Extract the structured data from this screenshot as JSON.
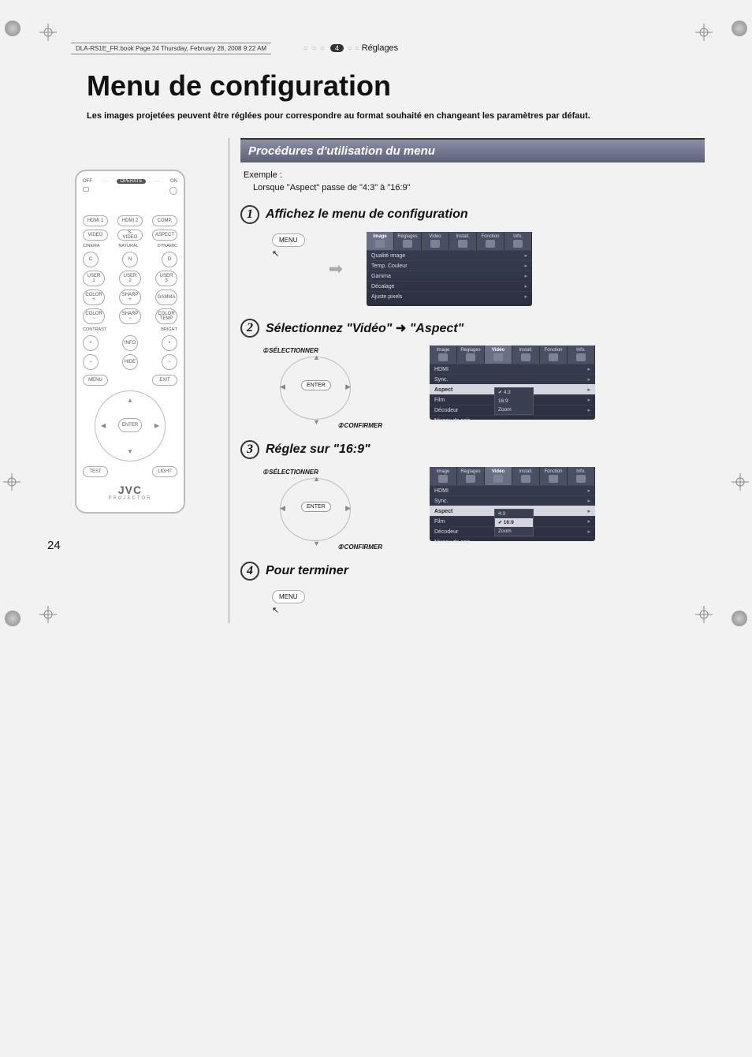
{
  "header_line": "DLA-RS1E_FR.book  Page 24  Thursday, February 28, 2008  9:22 AM",
  "section_badge": "4",
  "section_label": "Réglages",
  "title": "Menu de configuration",
  "intro": "Les images projetées peuvent être réglées pour correspondre au format souhaité en changeant les paramètres par défaut.",
  "procedures_title": "Procédures d'utilisation du menu",
  "example_label": "Exemple :",
  "example_text": "Lorsque \"Aspect\" passe de \"4:3\" à \"16:9\"",
  "steps": [
    {
      "num": "1",
      "title": "Affichez le menu de configuration"
    },
    {
      "num": "2",
      "title_a": "Sélectionnez \"Vidéo\"",
      "title_b": "\"Aspect\""
    },
    {
      "num": "3",
      "title": "Réglez sur \"16:9\""
    },
    {
      "num": "4",
      "title": "Pour terminer"
    }
  ],
  "labels": {
    "selectionner": "SÉLECTIONNER",
    "confirmer": "CONFIRMER",
    "menu": "MENU",
    "enter": "ENTER"
  },
  "osd_tabs": [
    "Image",
    "Réglages",
    "Vidéo",
    "Install.",
    "Fonction",
    "Info."
  ],
  "osd1_rows": [
    "Qualité image",
    "Temp. Couleur",
    "Gamma",
    "Décalage",
    "Ajuste.pixels"
  ],
  "osd2_rows": [
    "HDMI",
    "Sync.",
    "Aspect",
    "Film",
    "Décodeur",
    "Niveau de noir"
  ],
  "osd2_highlight": "Aspect",
  "osd2_options": [
    "4:3",
    "16:9",
    "Zoom"
  ],
  "osd2_checked": "4:3",
  "osd3_checked": "16:9",
  "remote": {
    "off": "OFF",
    "on": "ON",
    "operate": "OPERATE",
    "row1": [
      "HDMI 1",
      "HDMI 2",
      "COMP."
    ],
    "row2": [
      "VIDEO",
      "S-VIDEO",
      "ASPECT"
    ],
    "mode_labels": [
      "CINEMA",
      "NATURAL",
      "DYNAMIC"
    ],
    "row3": [
      "C",
      "N",
      "D"
    ],
    "row4": [
      "USER 1",
      "USER 2",
      "USER 3"
    ],
    "row5": [
      "COLOR +",
      "SHARP +",
      "GAMMA"
    ],
    "row6": [
      "COLOR −",
      "SHARP −",
      "COLOR TEMP"
    ],
    "contrast": "CONTRAST",
    "bright": "BRIGHT",
    "info": "INFO",
    "hide": "HIDE",
    "menu": "MENU",
    "exit": "EXIT",
    "enter": "ENTER",
    "test": "TEST",
    "light": "LIGHT",
    "brand": "JVC",
    "subtitle": "PROJECTOR"
  },
  "page_number": "24"
}
